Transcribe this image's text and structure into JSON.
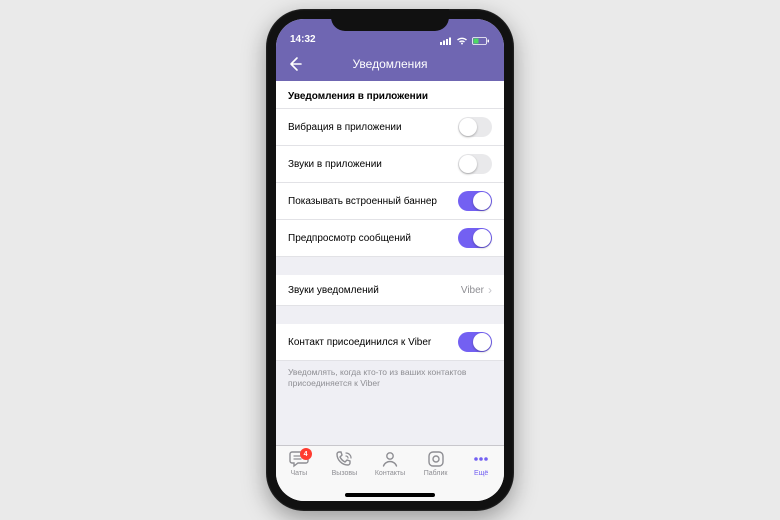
{
  "statusbar": {
    "time": "14:32"
  },
  "header": {
    "title": "Уведомления"
  },
  "section": {
    "title": "Уведомления в приложении"
  },
  "rows": {
    "vibration": {
      "label": "Вибрация в приложении",
      "on": false
    },
    "sounds": {
      "label": "Звуки в приложении",
      "on": false
    },
    "banner": {
      "label": "Показывать встроенный баннер",
      "on": true
    },
    "preview": {
      "label": "Предпросмотр сообщений",
      "on": true
    },
    "notif_sound": {
      "label": "Звуки уведомлений",
      "value": "Viber"
    },
    "contact_joined": {
      "label": "Контакт присоединился к Viber",
      "on": true
    }
  },
  "footer_note": "Уведомлять, когда кто-то из ваших контактов присоединяется к Viber",
  "tabs": {
    "chats": {
      "label": "Чаты",
      "badge": "4"
    },
    "calls": {
      "label": "Вызовы"
    },
    "contacts": {
      "label": "Контакты"
    },
    "public": {
      "label": "Паблик"
    },
    "more": {
      "label": "Ещё"
    }
  },
  "colors": {
    "accent": "#7360f2",
    "header": "#6f66b2"
  }
}
